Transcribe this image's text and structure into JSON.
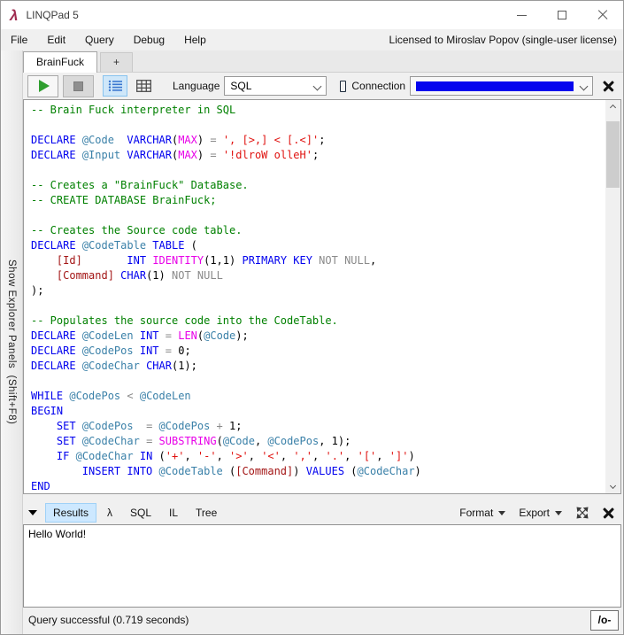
{
  "window": {
    "title": "LINQPad 5",
    "license": "Licensed to Miroslav Popov (single-user license)"
  },
  "icons": {
    "logo": "λ",
    "minimize": "thin-dash",
    "maximize": "square-outline",
    "close": "x-cross",
    "run": "green-play-triangle",
    "stop": "gray-stop-square",
    "rich_text_view": "blue-bullet-list",
    "grid_view": "data-grid",
    "connection_chip": "vertical-rectangle-outline",
    "results_collapse": "black-down-triangle",
    "arrange": "arrow-burst"
  },
  "menu": {
    "items": [
      "File",
      "Edit",
      "Query",
      "Debug",
      "Help"
    ]
  },
  "tabs": {
    "active": "BrainFuck",
    "new_tab_label": "+"
  },
  "toolbar": {
    "language_label": "Language",
    "language_value": "SQL",
    "connection_label": "Connection"
  },
  "left_rail": {
    "label": "Show Explorer Panels  (Shift+F8)"
  },
  "editor": {
    "lines": [
      [
        [
          "com",
          "-- Brain Fuck interpreter in SQL"
        ]
      ],
      [],
      [
        [
          "kw",
          "DECLARE"
        ],
        [
          "pl",
          " "
        ],
        [
          "var",
          "@Code"
        ],
        [
          "pl",
          "  "
        ],
        [
          "kw",
          "VARCHAR"
        ],
        [
          "pl",
          "("
        ],
        [
          "fn",
          "MAX"
        ],
        [
          "pl",
          ")"
        ],
        [
          "gr",
          " = "
        ],
        [
          "str",
          "', [>,] < [.<]'"
        ],
        [
          "pl",
          ";"
        ]
      ],
      [
        [
          "kw",
          "DECLARE"
        ],
        [
          "pl",
          " "
        ],
        [
          "var",
          "@Input"
        ],
        [
          "pl",
          " "
        ],
        [
          "kw",
          "VARCHAR"
        ],
        [
          "pl",
          "("
        ],
        [
          "fn",
          "MAX"
        ],
        [
          "pl",
          ")"
        ],
        [
          "gr",
          " = "
        ],
        [
          "str",
          "'!dlroW olleH'"
        ],
        [
          "pl",
          ";"
        ]
      ],
      [],
      [
        [
          "com",
          "-- Creates a \"BrainFuck\" DataBase."
        ]
      ],
      [
        [
          "com",
          "-- CREATE DATABASE BrainFuck;"
        ]
      ],
      [],
      [
        [
          "com",
          "-- Creates the Source code table."
        ]
      ],
      [
        [
          "kw",
          "DECLARE"
        ],
        [
          "pl",
          " "
        ],
        [
          "var",
          "@CodeTable"
        ],
        [
          "pl",
          " "
        ],
        [
          "kw",
          "TABLE"
        ],
        [
          "pl",
          " ("
        ]
      ],
      [
        [
          "pl",
          "    "
        ],
        [
          "id",
          "[Id]"
        ],
        [
          "pl",
          "       "
        ],
        [
          "kw",
          "INT"
        ],
        [
          "pl",
          " "
        ],
        [
          "fn",
          "IDENTITY"
        ],
        [
          "pl",
          "(1,1) "
        ],
        [
          "kw",
          "PRIMARY KEY"
        ],
        [
          "gr",
          " NOT NULL"
        ],
        [
          "pl",
          ","
        ]
      ],
      [
        [
          "pl",
          "    "
        ],
        [
          "id",
          "[Command]"
        ],
        [
          "pl",
          " "
        ],
        [
          "kw",
          "CHAR"
        ],
        [
          "pl",
          "(1)"
        ],
        [
          "gr",
          " NOT NULL"
        ]
      ],
      [
        [
          "pl",
          ");"
        ]
      ],
      [],
      [
        [
          "com",
          "-- Populates the source code into the CodeTable."
        ]
      ],
      [
        [
          "kw",
          "DECLARE"
        ],
        [
          "pl",
          " "
        ],
        [
          "var",
          "@CodeLen"
        ],
        [
          "pl",
          " "
        ],
        [
          "kw",
          "INT"
        ],
        [
          "gr",
          " = "
        ],
        [
          "fn",
          "LEN"
        ],
        [
          "pl",
          "("
        ],
        [
          "var",
          "@Code"
        ],
        [
          "pl",
          ");"
        ]
      ],
      [
        [
          "kw",
          "DECLARE"
        ],
        [
          "pl",
          " "
        ],
        [
          "var",
          "@CodePos"
        ],
        [
          "pl",
          " "
        ],
        [
          "kw",
          "INT"
        ],
        [
          "gr",
          " = "
        ],
        [
          "pl",
          "0;"
        ]
      ],
      [
        [
          "kw",
          "DECLARE"
        ],
        [
          "pl",
          " "
        ],
        [
          "var",
          "@CodeChar"
        ],
        [
          "pl",
          " "
        ],
        [
          "kw",
          "CHAR"
        ],
        [
          "pl",
          "(1);"
        ]
      ],
      [],
      [
        [
          "kw",
          "WHILE"
        ],
        [
          "pl",
          " "
        ],
        [
          "var",
          "@CodePos"
        ],
        [
          "gr",
          " < "
        ],
        [
          "var",
          "@CodeLen"
        ]
      ],
      [
        [
          "kw",
          "BEGIN"
        ]
      ],
      [
        [
          "pl",
          "    "
        ],
        [
          "kw",
          "SET"
        ],
        [
          "pl",
          " "
        ],
        [
          "var",
          "@CodePos"
        ],
        [
          "pl",
          "  "
        ],
        [
          "gr",
          "= "
        ],
        [
          "var",
          "@CodePos"
        ],
        [
          "gr",
          " + "
        ],
        [
          "pl",
          "1;"
        ]
      ],
      [
        [
          "pl",
          "    "
        ],
        [
          "kw",
          "SET"
        ],
        [
          "pl",
          " "
        ],
        [
          "var",
          "@CodeChar"
        ],
        [
          "gr",
          " = "
        ],
        [
          "fn",
          "SUBSTRING"
        ],
        [
          "pl",
          "("
        ],
        [
          "var",
          "@Code"
        ],
        [
          "pl",
          ", "
        ],
        [
          "var",
          "@CodePos"
        ],
        [
          "pl",
          ", 1);"
        ]
      ],
      [
        [
          "pl",
          "    "
        ],
        [
          "kw",
          "IF"
        ],
        [
          "pl",
          " "
        ],
        [
          "var",
          "@CodeChar"
        ],
        [
          "pl",
          " "
        ],
        [
          "kw",
          "IN"
        ],
        [
          "pl",
          " ("
        ],
        [
          "str",
          "'+'"
        ],
        [
          "pl",
          ", "
        ],
        [
          "str",
          "'-'"
        ],
        [
          "pl",
          ", "
        ],
        [
          "str",
          "'>'"
        ],
        [
          "pl",
          ", "
        ],
        [
          "str",
          "'<'"
        ],
        [
          "pl",
          ", "
        ],
        [
          "str",
          "','"
        ],
        [
          "pl",
          ", "
        ],
        [
          "str",
          "'.'"
        ],
        [
          "pl",
          ", "
        ],
        [
          "str",
          "'['"
        ],
        [
          "pl",
          ", "
        ],
        [
          "str",
          "']'"
        ],
        [
          "pl",
          ")"
        ]
      ],
      [
        [
          "pl",
          "        "
        ],
        [
          "kw",
          "INSERT INTO"
        ],
        [
          "pl",
          " "
        ],
        [
          "var",
          "@CodeTable"
        ],
        [
          "pl",
          " ("
        ],
        [
          "id",
          "[Command]"
        ],
        [
          "pl",
          ") "
        ],
        [
          "kw",
          "VALUES"
        ],
        [
          "pl",
          " ("
        ],
        [
          "var",
          "@CodeChar"
        ],
        [
          "pl",
          ")"
        ]
      ],
      [
        [
          "kw",
          "END"
        ]
      ]
    ]
  },
  "results": {
    "tabs": [
      "Results",
      "λ",
      "SQL",
      "IL",
      "Tree"
    ],
    "active_tab": "Results",
    "format_label": "Format",
    "export_label": "Export",
    "output": "Hello World!"
  },
  "status": {
    "message": "Query successful  (0.719 seconds)",
    "right_button": "/o-"
  },
  "colors": {
    "brand": "#a02c50",
    "redaction": "#0505ee",
    "syntax_comment": "#008000",
    "syntax_keyword": "#0000ee",
    "syntax_variable": "#3a80a8",
    "syntax_function": "#e800e8",
    "syntax_string": "#e01310",
    "syntax_bracket_ident": "#a31515",
    "syntax_gray": "#8a8a8a",
    "syntax_plain": "#000000",
    "results_tab_active_bg": "#cde8ff"
  }
}
